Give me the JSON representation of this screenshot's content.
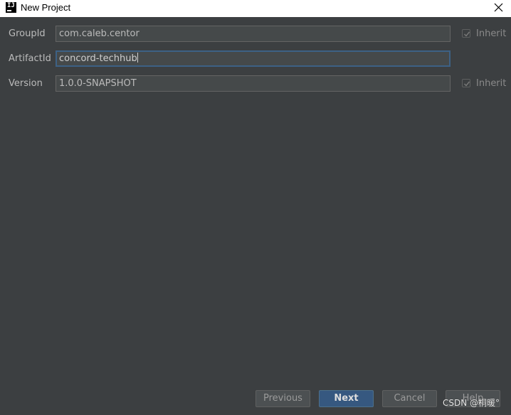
{
  "window": {
    "title": "New Project",
    "app_icon_text": "IJ"
  },
  "form": {
    "group_id": {
      "label": "GroupId",
      "value": "com.caleb.centor",
      "inherit_label": "Inherit",
      "inherit_checked": true
    },
    "artifact_id": {
      "label": "ArtifactId",
      "value": "concord-techhub"
    },
    "version": {
      "label": "Version",
      "value": "1.0.0-SNAPSHOT",
      "inherit_label": "Inherit",
      "inherit_checked": true
    }
  },
  "buttons": {
    "previous": "Previous",
    "next": "Next",
    "cancel": "Cancel",
    "help": "Help"
  },
  "watermark": "CSDN @桐暖°",
  "colors": {
    "background": "#3c3f41",
    "field_background": "#45494a",
    "focus_border": "#3d6185",
    "primary_button": "#365880",
    "text": "#bbbbbb"
  }
}
